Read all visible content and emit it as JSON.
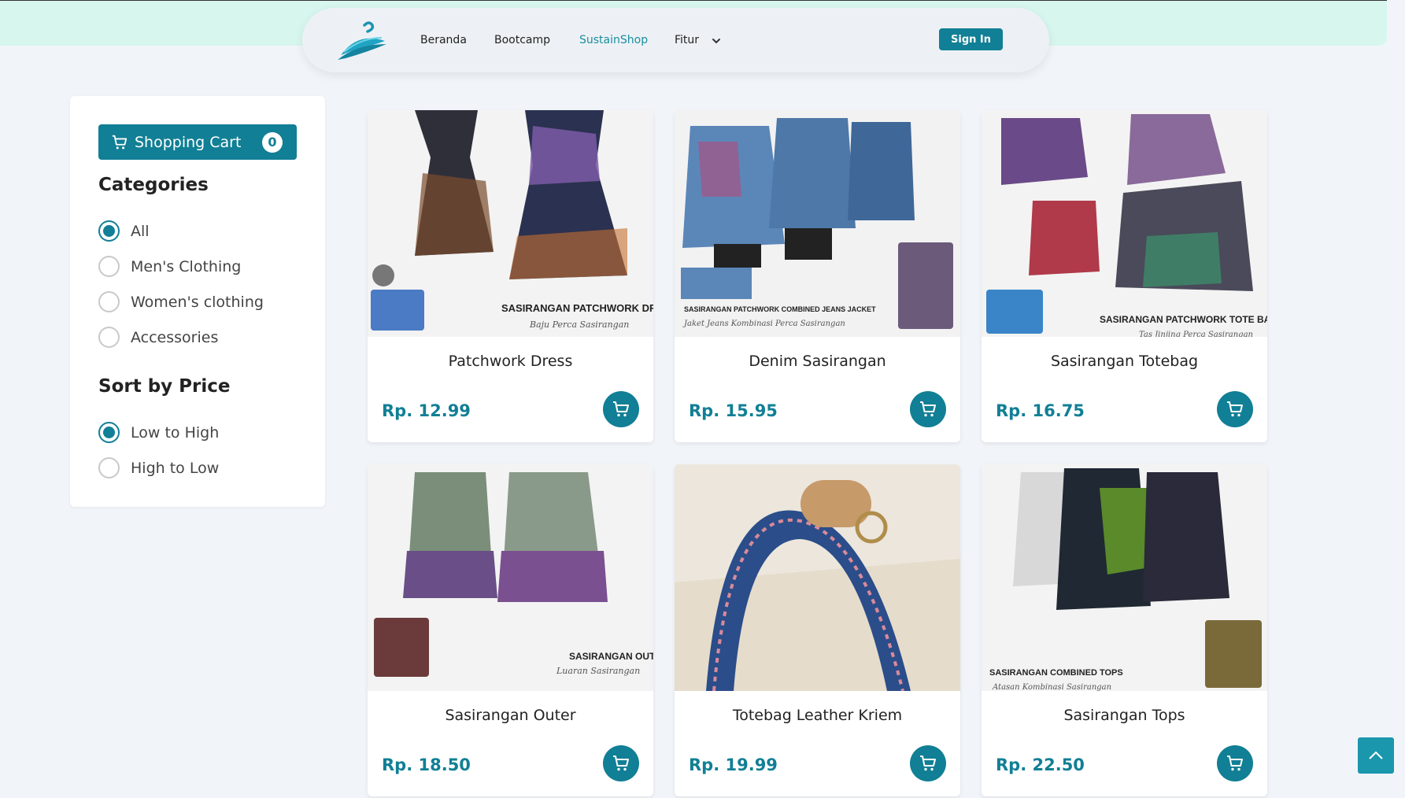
{
  "nav": {
    "items": [
      {
        "label": "Beranda",
        "active": false
      },
      {
        "label": "Bootcamp",
        "active": false
      },
      {
        "label": "SustainShop",
        "active": true
      },
      {
        "label": "Fitur",
        "active": false
      }
    ],
    "signin_label": "Sign In"
  },
  "sidebar": {
    "cart_label": "Shopping Cart",
    "cart_count": "0",
    "categories_heading": "Categories",
    "categories": [
      {
        "label": "All",
        "checked": true
      },
      {
        "label": "Men's Clothing",
        "checked": false
      },
      {
        "label": "Women's clothing",
        "checked": false
      },
      {
        "label": "Accessories",
        "checked": false
      }
    ],
    "sort_heading": "Sort by Price",
    "sort_options": [
      {
        "label": "Low to High",
        "checked": true
      },
      {
        "label": "High to Low",
        "checked": false
      }
    ]
  },
  "products": [
    {
      "name": "Patchwork Dress",
      "price": "Rp. 12.99",
      "image_caption": "SASIRANGAN PATCHWORK DRESS",
      "image_subcaption": "Baju Perca Sasirangan"
    },
    {
      "name": "Denim Sasirangan",
      "price": "Rp. 15.95",
      "image_caption": "SASIRANGAN PATCHWORK COMBINED JEANS JACKET",
      "image_subcaption": "Jaket Jeans Kombinasi Perca Sasirangan"
    },
    {
      "name": "Sasirangan Totebag",
      "price": "Rp. 16.75",
      "image_caption": "SASIRANGAN PATCHWORK TOTE BAG",
      "image_subcaption": "Tas Jinjing Perca Sasirangan"
    },
    {
      "name": "Sasirangan Outer",
      "price": "Rp. 18.50",
      "image_caption": "SASIRANGAN OUTER",
      "image_subcaption": "Luaran Sasirangan"
    },
    {
      "name": "Totebag Leather Kriem",
      "price": "Rp. 19.99",
      "image_caption": "",
      "image_subcaption": ""
    },
    {
      "name": "Sasirangan Tops",
      "price": "Rp. 22.50",
      "image_caption": "SASIRANGAN COMBINED TOPS",
      "image_subcaption": "Atasan Kombinasi Sasirangan"
    }
  ],
  "colors": {
    "accent": "#117f95",
    "top_band": "#d6f6ee",
    "page_bg": "#f1f5f9"
  }
}
